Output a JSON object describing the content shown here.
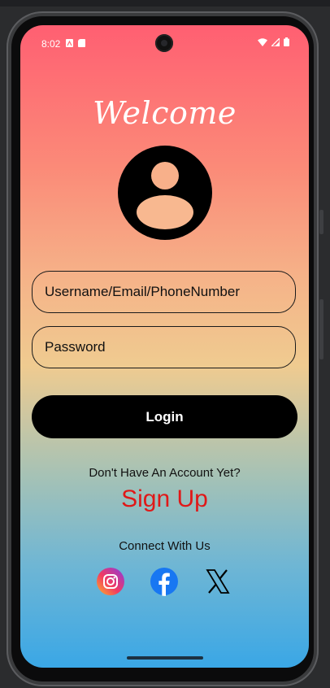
{
  "status_bar": {
    "time": "8:02"
  },
  "header": {
    "title": "Welcome"
  },
  "form": {
    "username_placeholder": "Username/Email/PhoneNumber",
    "password_placeholder": "Password",
    "login_label": "Login"
  },
  "signup_section": {
    "prompt": "Don't Have An Account Yet?",
    "signup_label": "Sign Up"
  },
  "social": {
    "heading": "Connect With Us",
    "icons": [
      "instagram-icon",
      "facebook-icon",
      "x-icon"
    ]
  },
  "colors": {
    "gradient_top": "#ff5f72",
    "gradient_middle": "#efcb90",
    "gradient_bottom": "#3aa7e6",
    "signup": "#e01818",
    "button": "#000000"
  }
}
